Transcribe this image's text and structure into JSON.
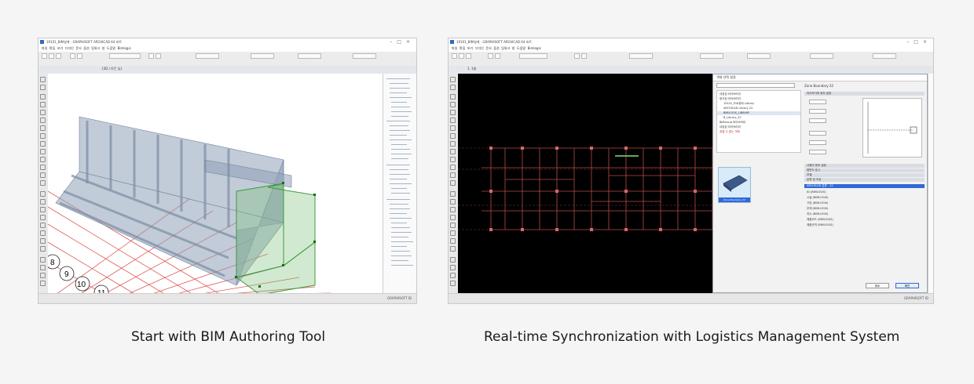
{
  "captions": {
    "left": "Start with BIM Authoring Tool",
    "right": "Real-time Synchronization with Logistics Management System"
  },
  "left_app": {
    "title": "19101_BIM설계 - GRAPHISOFT ARCHICAD 64 비트",
    "menu": [
      "파일",
      "편집",
      "보기",
      "디자인",
      "문서",
      "옵션",
      "팀워크",
      "창",
      "도움말",
      "Bimlogis"
    ],
    "view_tab": "{3D / 모든 뷰}",
    "grid_labels": [
      "8",
      "9",
      "10",
      "11"
    ],
    "status_text": "GRAPHISOFT ID",
    "colors": {
      "structure": "#8fa1b8",
      "selected": "#6aa96a",
      "grid": "#e05a5a"
    }
  },
  "right_app": {
    "title": "19101_BIM설계 - GRAPHISOFT ARCHICAD 64 비트",
    "menu": [
      "파일",
      "편집",
      "보기",
      "디자인",
      "문서",
      "옵션",
      "팀워크",
      "창",
      "도움말",
      "Bimlogis"
    ],
    "plan_tab": "1. 1층",
    "dialog": {
      "title": "객체 선택 설정",
      "object_name": "Zone Boundary 22",
      "library_tree": [
        "내장된 라이브러리",
        "링크된 라이브러리",
        "19101_도로정비 Library",
        "ARCHICAD Library 22",
        "BIMLOGIS_LIBRARY",
        "B_Library_22",
        "BIMcloud 라이브러리",
        "내장된 라이브러리",
        "찾을 수 없는 객체"
      ],
      "preview_label": "Zone Boundary 22",
      "sections": [
        "미리보기와 위치 설정",
        "사용자 정의 설정",
        "평면도 표시",
        "모델",
        "분류 및 속성"
      ],
      "selected_row": "ARCHICAD 분류 - 22",
      "property_rows": [
        "ID (BIMLOGIS)",
        "시설 (BIMLOGIS)",
        "구분 (BIMLOGIS)",
        "부재 (BIMLOGIS)",
        "치수 (BIMLOGIS)",
        "제품코드 (BIMLOGIS)",
        "제품규격 (BIMLOGIS)"
      ],
      "cancel_label": "취소",
      "ok_label": "확인"
    },
    "status_text": "GRAPHISOFT ID",
    "colors": {
      "canvas": "#000000",
      "plan_lines": "#b84a4a",
      "highlight": "#7fe07f"
    }
  }
}
